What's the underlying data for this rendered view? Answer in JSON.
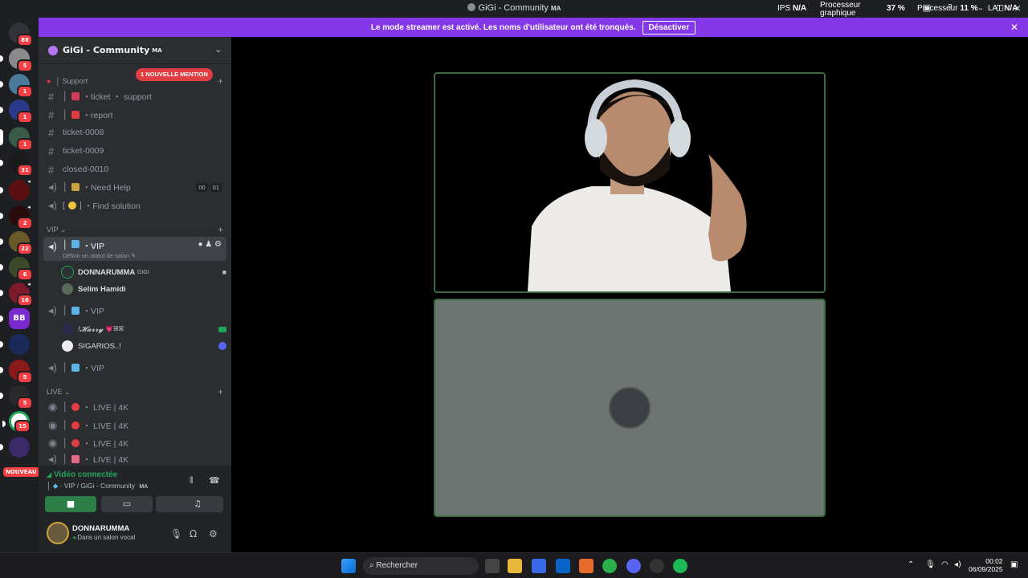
{
  "window": {
    "title": "GiGi - Community",
    "title_suffix": "MA",
    "ips_label": "IPS",
    "ips_value": "N/A",
    "gpu_label": "Processeur graphique",
    "gpu_value": "37 %",
    "cpu_label": "Processeur",
    "cpu_value": "11 %",
    "lat_label": "LAT",
    "lat_value": "N/A"
  },
  "banner": {
    "text": "Le mode streamer est activé. Les noms d'utilisateur ont été tronqués.",
    "button": "Désactiver",
    "close": "✕"
  },
  "rail": {
    "badges": [
      "88",
      "5",
      "1",
      "1",
      "1",
      "31",
      "2",
      "22",
      "6",
      "16",
      "5",
      "5",
      "15"
    ],
    "nouveau": "NOUVEAU",
    "bb_label": "BB"
  },
  "guild": {
    "name": "GiGi - Community",
    "suffix": "MA"
  },
  "categories": {
    "support": "Support",
    "vip": "VIP",
    "live": "LIVE"
  },
  "mention_badge": "1 NOUVELLE MENTION",
  "channels": {
    "ticket_support": "・ticket ・ support",
    "report": "・report",
    "ticket_0008": "ticket-0008",
    "ticket_0009": "ticket-0009",
    "closed_0010": "closed-0010",
    "need_help": "・Need Help",
    "need_help_c1": "00",
    "need_help_c2": "01",
    "find_solution": "・Find solution",
    "vip_active": "・VIP",
    "vip_status": "Définir un statut de salon",
    "vip_2": "・VIP",
    "vip_3": "・VIP",
    "live_1": "・ LIVE | 4K",
    "live_2": "・ LIVE | 4K",
    "live_3": "・ LIVE | 4K",
    "live_4": "・ LIVE | 4K"
  },
  "voice_users": {
    "u1": "DONNARUMMA",
    "u1_tag": "GIGI",
    "u2": "Selim Hamidi",
    "u3": "!𝓗𝓪𝓻𝓻𝔂",
    "u3_suffix": "💗ꕤꕤ",
    "u4": "SIGARIOS..!"
  },
  "voice_panel": {
    "status": "Vidéo connectée",
    "channel": "VIP / GiGi - Community",
    "channel_suffix": "MA"
  },
  "user_panel": {
    "name": "DONNARUMMA",
    "status": "Dans un salon vocal"
  },
  "taskbar": {
    "search_placeholder": "Rechercher",
    "time": "00:02",
    "date": "06/09/2025"
  },
  "colors": {
    "banner": "#8438e8",
    "connected": "#23a55a",
    "badge": "#f23f43",
    "tile_border": "#3a6b3d"
  }
}
